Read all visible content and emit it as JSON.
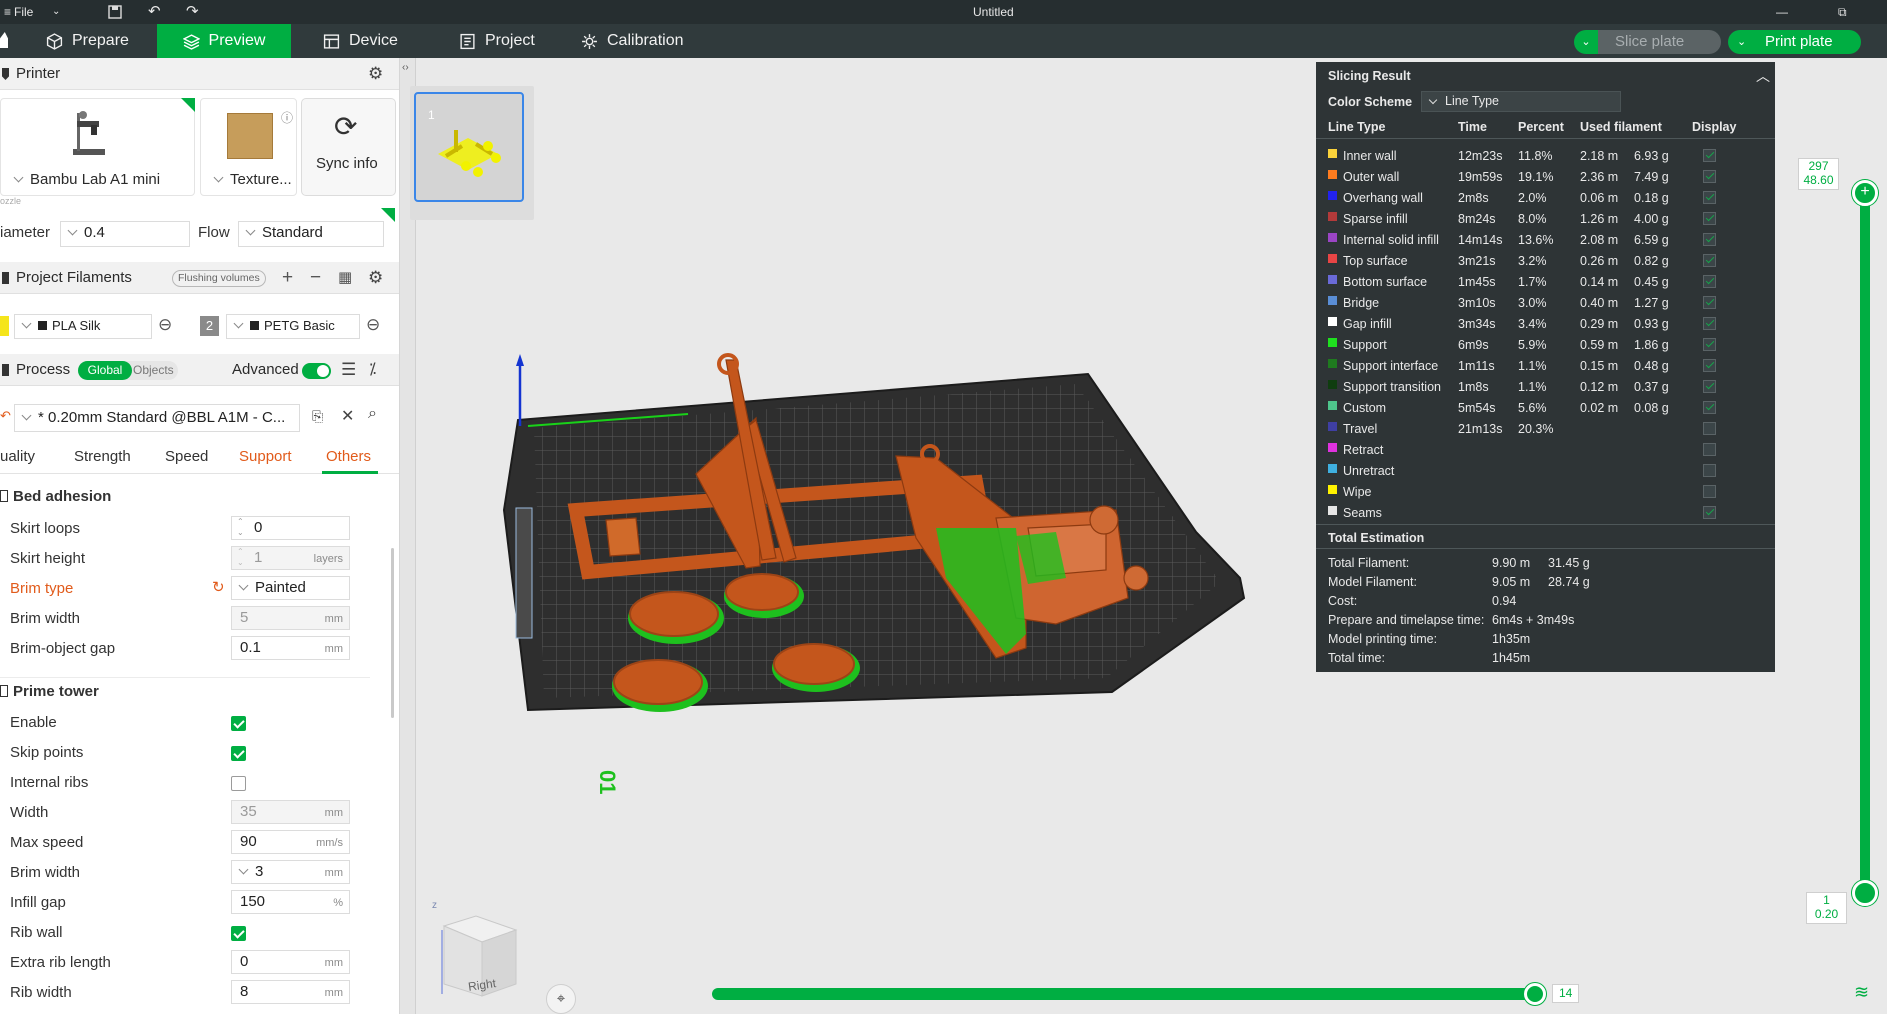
{
  "titlebar": {
    "file_menu": "File",
    "doc_title": "Untitled"
  },
  "nav": {
    "tabs": [
      {
        "label": "Prepare",
        "icon": "cube-icon"
      },
      {
        "label": "Preview",
        "icon": "layers-icon",
        "active": true
      },
      {
        "label": "Device",
        "icon": "device-icon"
      },
      {
        "label": "Project",
        "icon": "project-icon"
      },
      {
        "label": "Calibration",
        "icon": "calibration-icon"
      }
    ],
    "slice_label": "Slice plate",
    "print_label": "Print plate"
  },
  "printer": {
    "section_title": "Printer",
    "name": "Bambu Lab A1 mini",
    "plate": "Texture...",
    "sync": "Sync info",
    "nozzle_caption": "ozzle",
    "diameter_label": "iameter",
    "diameter_value": "0.4",
    "flow_label": "Flow",
    "flow_value": "Standard"
  },
  "filaments": {
    "section_title": "Project Filaments",
    "flushing": "Flushing volumes",
    "items": [
      {
        "index": "",
        "name": "PLA Silk",
        "color": "#f5e51b"
      },
      {
        "index": "2",
        "name": "PETG Basic",
        "color": "#8a8a8a"
      }
    ]
  },
  "process": {
    "section_title": "Process",
    "toggle_global": "Global",
    "toggle_objects": "Objects",
    "advanced": "Advanced",
    "preset": "* 0.20mm Standard @BBL A1M - C...",
    "tabs": [
      "uality",
      "Strength",
      "Speed",
      "Support",
      "Others"
    ],
    "groups": {
      "bed_adhesion": {
        "title": "Bed adhesion",
        "skirt_loops": {
          "label": "Skirt loops",
          "value": "0"
        },
        "skirt_height": {
          "label": "Skirt height",
          "value": "1",
          "unit": "layers"
        },
        "brim_type": {
          "label": "Brim type",
          "value": "Painted"
        },
        "brim_width": {
          "label": "Brim width",
          "value": "5",
          "unit": "mm"
        },
        "brim_gap": {
          "label": "Brim-object gap",
          "value": "0.1",
          "unit": "mm"
        }
      },
      "prime_tower": {
        "title": "Prime tower",
        "enable": {
          "label": "Enable",
          "checked": true
        },
        "skip_points": {
          "label": "Skip points",
          "checked": true
        },
        "internal_ribs": {
          "label": "Internal ribs",
          "checked": false
        },
        "width": {
          "label": "Width",
          "value": "35",
          "unit": "mm"
        },
        "max_speed": {
          "label": "Max speed",
          "value": "90",
          "unit": "mm/s"
        },
        "brim_width": {
          "label": "Brim width",
          "value": "3",
          "unit": "mm"
        },
        "infill_gap": {
          "label": "Infill gap",
          "value": "150",
          "unit": "%"
        },
        "rib_wall": {
          "label": "Rib wall",
          "checked": true
        },
        "extra_rib": {
          "label": "Extra rib length",
          "value": "0",
          "unit": "mm"
        },
        "rib_width": {
          "label": "Rib width",
          "value": "8",
          "unit": "mm"
        }
      }
    }
  },
  "viewport": {
    "plate_number": "1",
    "bed_number": "01",
    "layer_top": "297",
    "layer_top_height": "48.60",
    "layer_bottom": "1",
    "layer_bottom_height": "0.20",
    "move_value": "14",
    "view_cube_label": "Right",
    "axis_z": "z"
  },
  "slicing_result": {
    "title": "Slicing Result",
    "color_scheme_label": "Color Scheme",
    "color_scheme_value": "Line Type",
    "columns": [
      "Line Type",
      "Time",
      "Percent",
      "Used filament",
      "Display"
    ],
    "rows": [
      {
        "type": "Inner wall",
        "color": "#fbd33b",
        "time": "12m23s",
        "percent": "11.8%",
        "len": "2.18 m",
        "weight": "6.93 g",
        "display": true
      },
      {
        "type": "Outer wall",
        "color": "#ff7c1f",
        "time": "19m59s",
        "percent": "19.1%",
        "len": "2.36 m",
        "weight": "7.49 g",
        "display": true
      },
      {
        "type": "Overhang wall",
        "color": "#2222ee",
        "time": "2m8s",
        "percent": "2.0%",
        "len": "0.06 m",
        "weight": "0.18 g",
        "display": true
      },
      {
        "type": "Sparse infill",
        "color": "#b33a3a",
        "time": "8m24s",
        "percent": "8.0%",
        "len": "1.26 m",
        "weight": "4.00 g",
        "display": true
      },
      {
        "type": "Internal solid infill",
        "color": "#9b45c5",
        "time": "14m14s",
        "percent": "13.6%",
        "len": "2.08 m",
        "weight": "6.59 g",
        "display": true
      },
      {
        "type": "Top surface",
        "color": "#e84545",
        "time": "3m21s",
        "percent": "3.2%",
        "len": "0.26 m",
        "weight": "0.82 g",
        "display": true
      },
      {
        "type": "Bottom surface",
        "color": "#6a6ad8",
        "time": "1m45s",
        "percent": "1.7%",
        "len": "0.14 m",
        "weight": "0.45 g",
        "display": true
      },
      {
        "type": "Bridge",
        "color": "#5a8ed6",
        "time": "3m10s",
        "percent": "3.0%",
        "len": "0.40 m",
        "weight": "1.27 g",
        "display": true
      },
      {
        "type": "Gap infill",
        "color": "#ffffff",
        "time": "3m34s",
        "percent": "3.4%",
        "len": "0.29 m",
        "weight": "0.93 g",
        "display": true
      },
      {
        "type": "Support",
        "color": "#1fe01f",
        "time": "6m9s",
        "percent": "5.9%",
        "len": "0.59 m",
        "weight": "1.86 g",
        "display": true
      },
      {
        "type": "Support interface",
        "color": "#1f7a1f",
        "time": "1m11s",
        "percent": "1.1%",
        "len": "0.15 m",
        "weight": "0.48 g",
        "display": true
      },
      {
        "type": "Support transition",
        "color": "#0f3d0f",
        "time": "1m8s",
        "percent": "1.1%",
        "len": "0.12 m",
        "weight": "0.37 g",
        "display": true
      },
      {
        "type": "Custom",
        "color": "#4ec58c",
        "time": "5m54s",
        "percent": "5.6%",
        "len": "0.02 m",
        "weight": "0.08 g",
        "display": true
      },
      {
        "type": "Travel",
        "color": "#3f3fa3",
        "time": "21m13s",
        "percent": "20.3%",
        "len": "",
        "weight": "",
        "display": false
      },
      {
        "type": "Retract",
        "color": "#e032e0",
        "time": "",
        "percent": "",
        "len": "",
        "weight": "",
        "display": false
      },
      {
        "type": "Unretract",
        "color": "#3fb0e0",
        "time": "",
        "percent": "",
        "len": "",
        "weight": "",
        "display": false
      },
      {
        "type": "Wipe",
        "color": "#fff200",
        "time": "",
        "percent": "",
        "len": "",
        "weight": "",
        "display": false
      },
      {
        "type": "Seams",
        "color": "#e6e6e6",
        "time": "",
        "percent": "",
        "len": "",
        "weight": "",
        "display": true
      }
    ],
    "total_title": "Total Estimation",
    "totals": [
      {
        "label": "Total Filament:",
        "v1": "9.90 m",
        "v2": "31.45 g"
      },
      {
        "label": "Model Filament:",
        "v1": "9.05 m",
        "v2": "28.74 g"
      },
      {
        "label": "Cost:",
        "v1": "0.94",
        "v2": ""
      },
      {
        "label": "Prepare and timelapse time:",
        "v1": "6m4s + 3m49s",
        "v2": ""
      },
      {
        "label": "Model printing time:",
        "v1": "1h35m",
        "v2": ""
      },
      {
        "label": "Total time:",
        "v1": "1h45m",
        "v2": ""
      }
    ]
  }
}
